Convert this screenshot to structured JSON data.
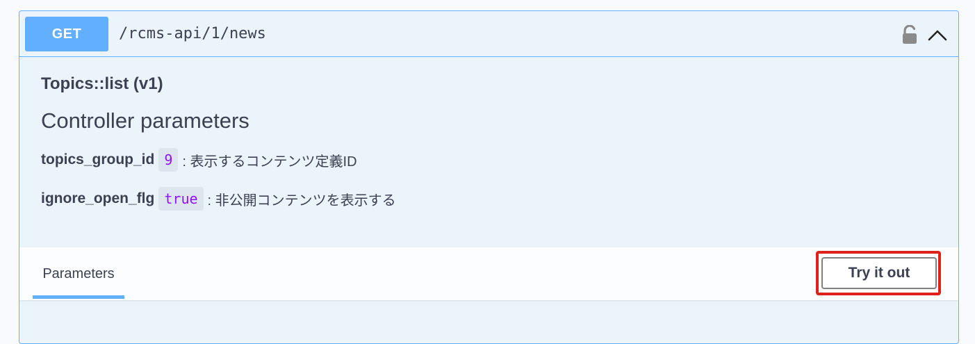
{
  "operation": {
    "method": "GET",
    "path": "/rcms-api/1/news",
    "lock_icon": "unlocked-padlock-icon",
    "collapse_icon": "chevron-up-icon"
  },
  "description": {
    "summary": "Topics::list (v1)",
    "section_title": "Controller parameters",
    "params": [
      {
        "name": "topics_group_id",
        "value": "9",
        "desc": ": 表示するコンテンツ定義ID"
      },
      {
        "name": "ignore_open_flg",
        "value": "true",
        "desc": ": 非公開コンテンツを表示する"
      }
    ]
  },
  "tabs": {
    "parameters_label": "Parameters",
    "try_label": "Try it out"
  },
  "colors": {
    "accent": "#61affe",
    "background": "#ebf3fb",
    "value_text": "#9012fe",
    "highlight": "#e0201a"
  }
}
